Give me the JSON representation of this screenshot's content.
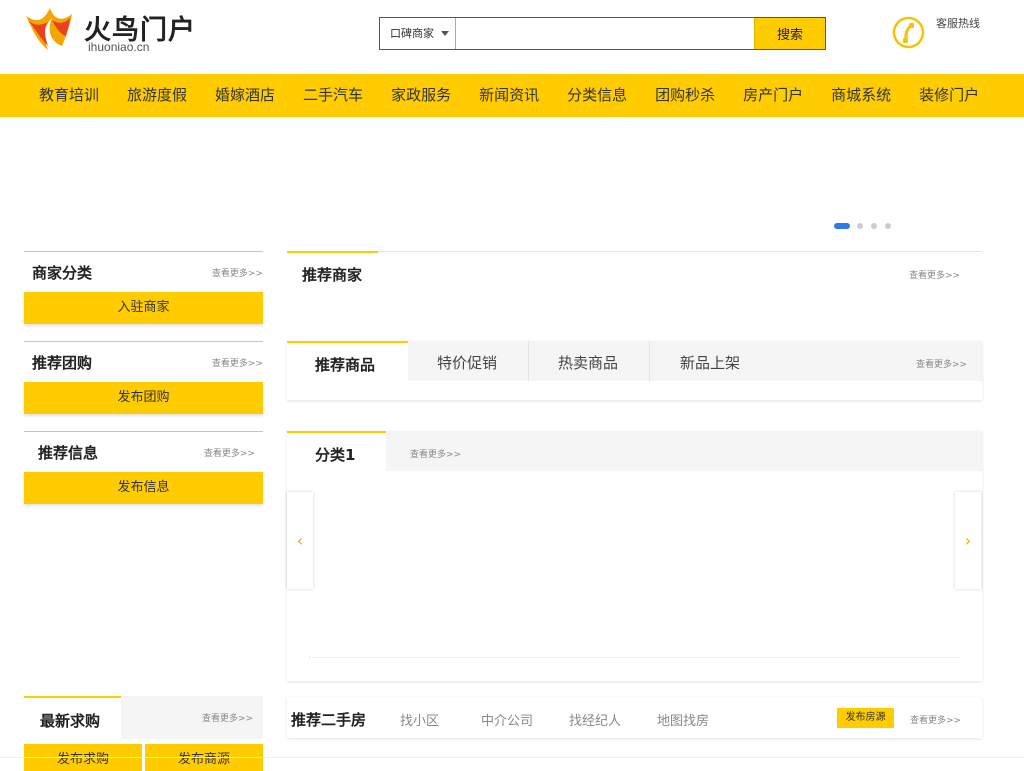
{
  "header": {
    "logo_title": "火鸟门户",
    "logo_domain": "ihuoniao.cn",
    "search": {
      "type_label": "口碑商家",
      "placeholder": "",
      "button_label": "搜索"
    },
    "hotline_label": "客服热线"
  },
  "nav": {
    "items": [
      "教育培训",
      "旅游度假",
      "婚嫁酒店",
      "二手汽车",
      "家政服务",
      "新闻资讯",
      "分类信息",
      "团购秒杀",
      "房产门户",
      "商城系统",
      "装修门户"
    ]
  },
  "more_label": "查看更多>>",
  "sidebar": {
    "merchant_category": {
      "title": "商家分类",
      "button": "入驻商家"
    },
    "group_buy": {
      "title": "推荐团购",
      "button": "发布团购"
    },
    "info": {
      "title": "推荐信息",
      "button": "发布信息"
    },
    "wanted": {
      "title": "最新求购",
      "buttons": [
        "发布求购",
        "发布商源"
      ]
    }
  },
  "main": {
    "merchants": {
      "title": "推荐商家"
    },
    "products": {
      "tabs": [
        "推荐商品",
        "特价促销",
        "热卖商品",
        "新品上架"
      ]
    },
    "category": {
      "tab": "分类1"
    },
    "second_hand": {
      "title": "推荐二手房",
      "links": [
        "找小区",
        "中介公司",
        "找经纪人",
        "地图找房"
      ],
      "publish_button": "发布房源"
    }
  },
  "colors": {
    "accent": "#ffcc00",
    "active_dot": "#2d7be5"
  },
  "icons": {
    "prev": "chevron-left-icon",
    "next": "chevron-right-icon",
    "hotline": "phone-icon"
  }
}
